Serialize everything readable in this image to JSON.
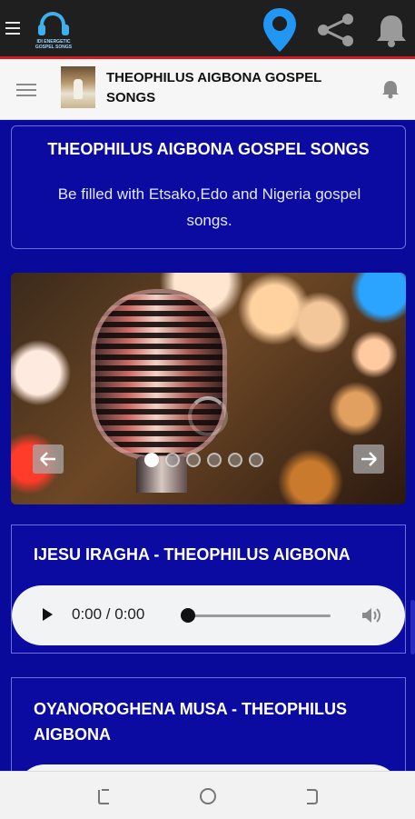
{
  "app": {
    "logo_text": "IDI ENERGETIC GOSPEL SONGS",
    "header_title": "THEOPHILUS AIGBONA GOSPEL SONGS"
  },
  "intro": {
    "title": "THEOPHILUS AIGBONA GOSPEL SONGS",
    "subtitle": "Be filled with Etsako,Edo and Nigeria gospel songs."
  },
  "slider": {
    "slide_count": 6,
    "active_index": 0
  },
  "songs": [
    {
      "title": "IJESU IRAGHA - THEOPHILUS AIGBONA",
      "time": "0:00 / 0:00",
      "progress": 0
    },
    {
      "title": "OYANOROGHENA MUSA - THEOPHILUS AIGBONA"
    }
  ],
  "colors": {
    "background": "#0a0a9a",
    "accent_red": "#d01c1c",
    "pin_blue": "#2196f3"
  }
}
